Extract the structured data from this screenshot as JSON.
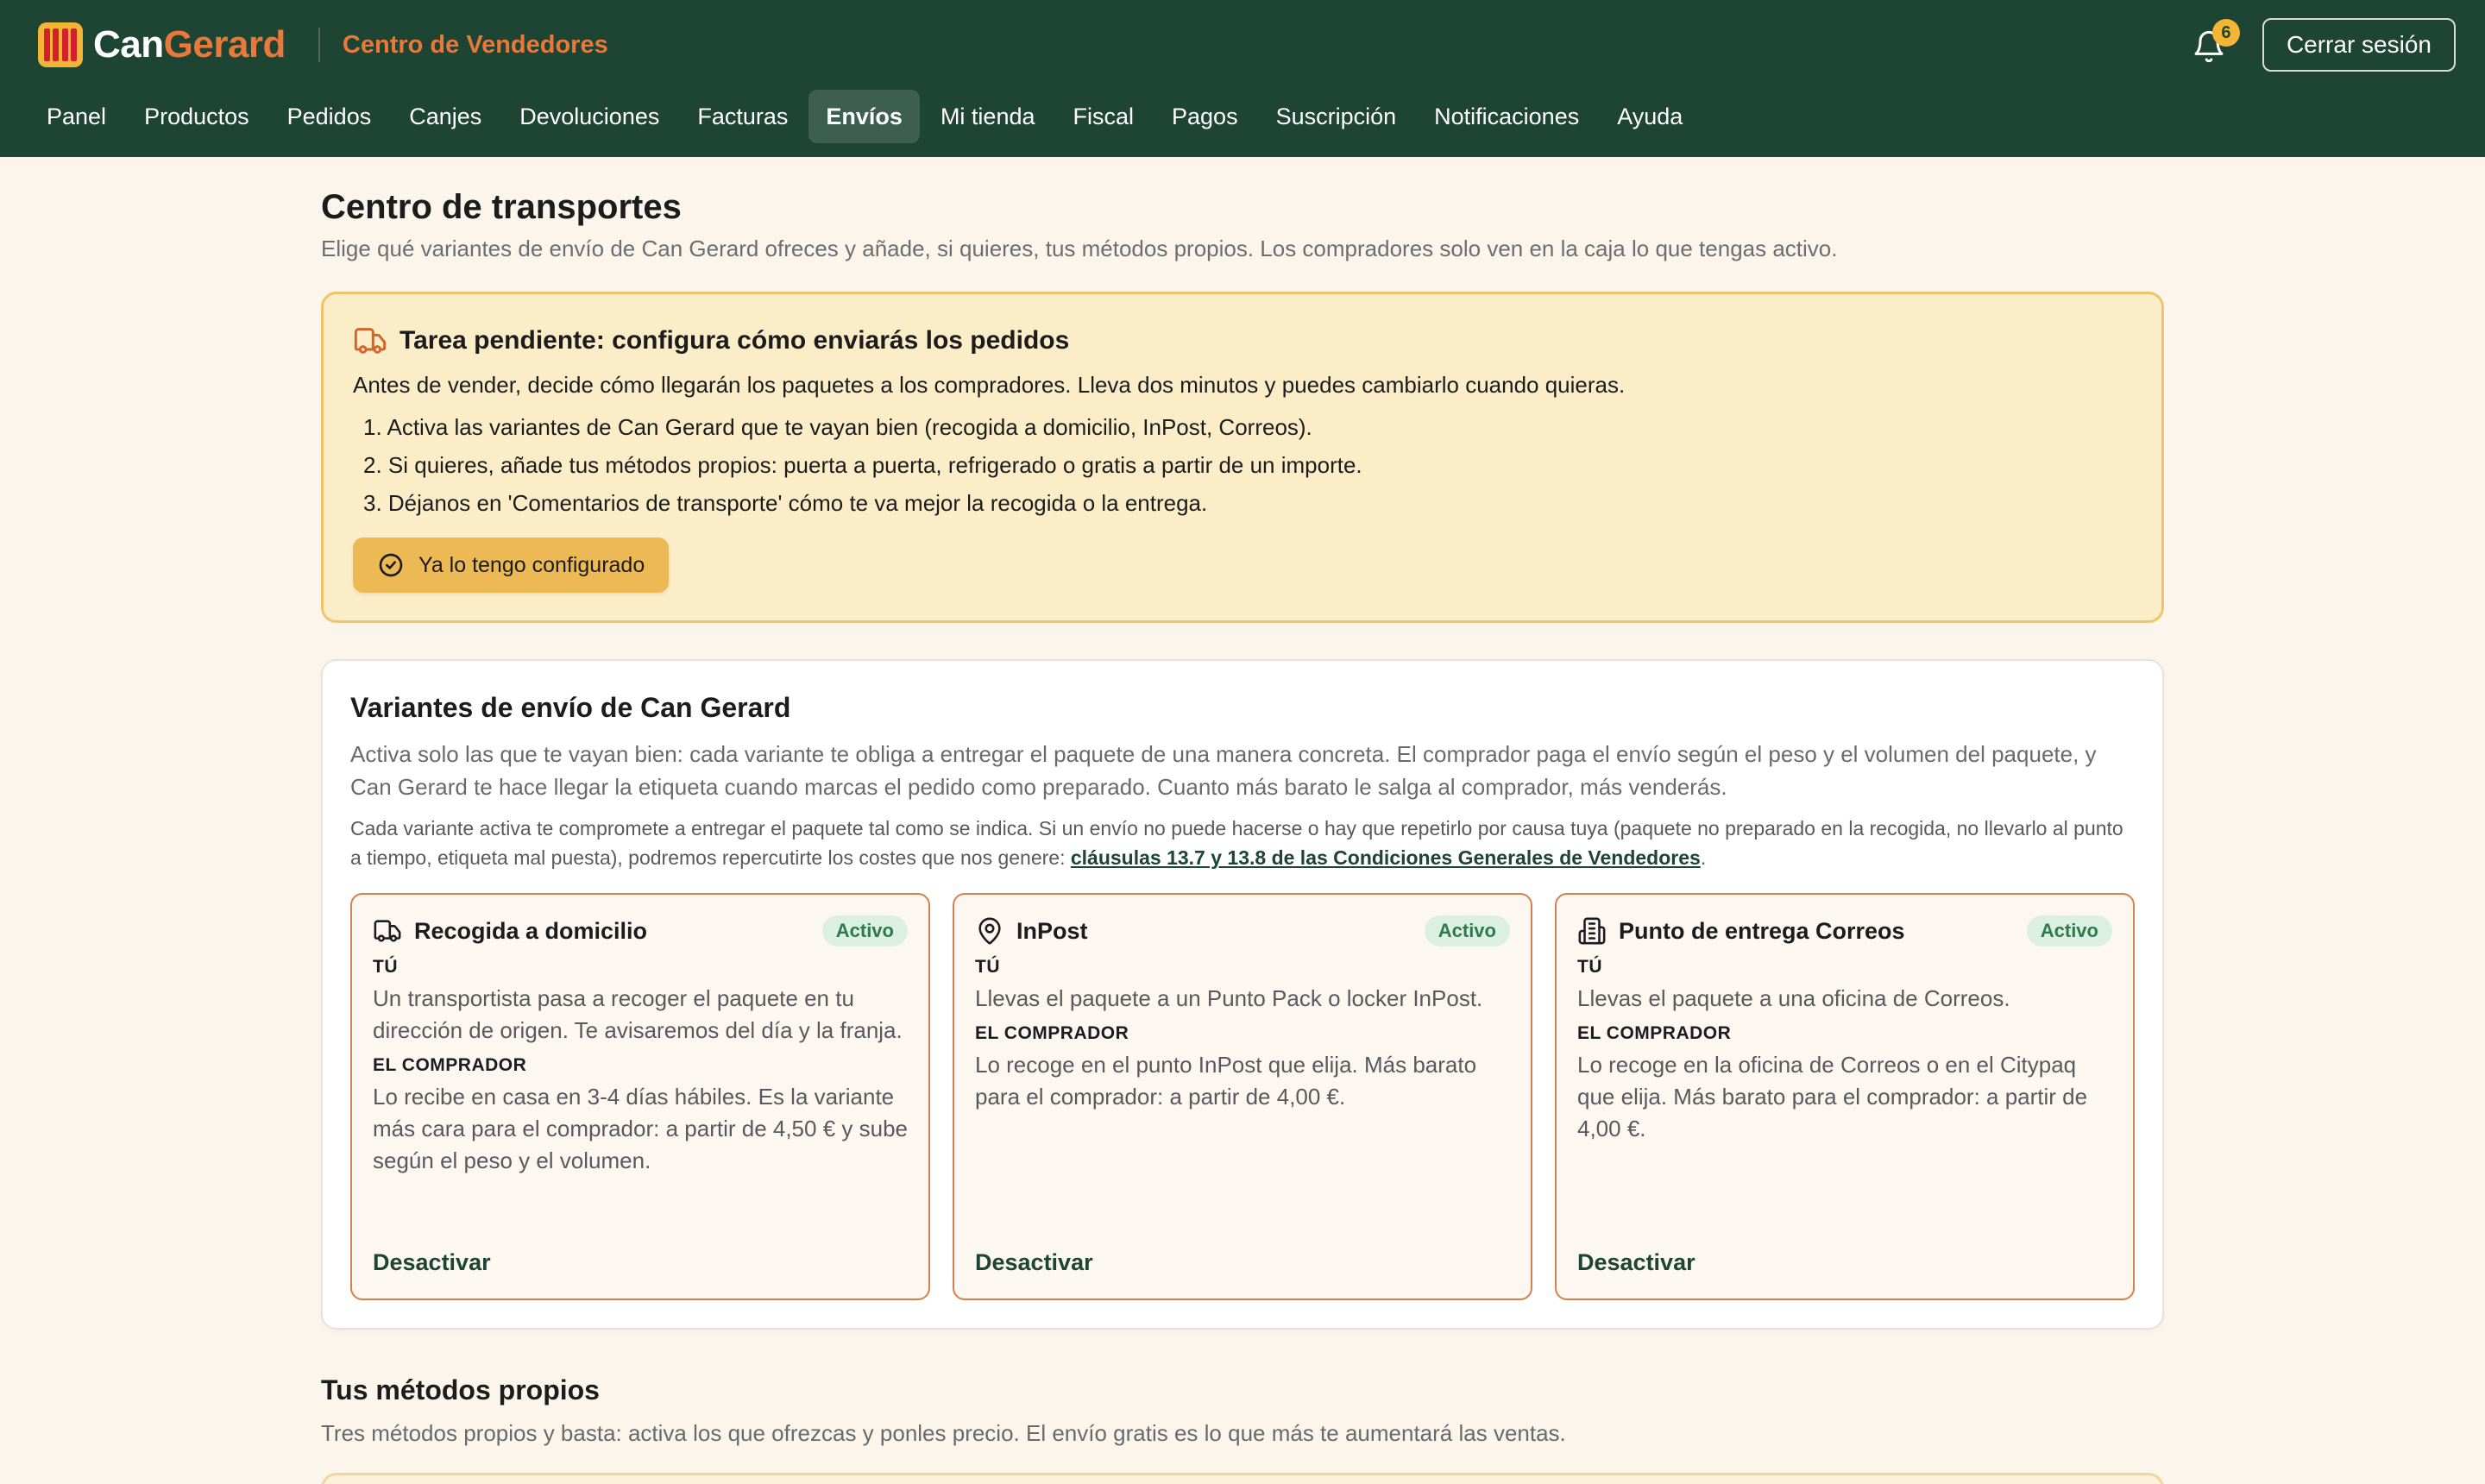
{
  "brand": {
    "name_part1": "Can",
    "name_part2": "Gerard",
    "portal": "Centro de Vendedores",
    "colors": {
      "header_bg": "#1e4433",
      "accent_orange": "#e8793b",
      "accent_yellow": "#f2b634"
    }
  },
  "header": {
    "notifications_count": "6",
    "logout_label": "Cerrar sesión",
    "bell_icon": "bell-icon"
  },
  "nav": {
    "items": [
      {
        "label": "Panel"
      },
      {
        "label": "Productos"
      },
      {
        "label": "Pedidos"
      },
      {
        "label": "Canjes"
      },
      {
        "label": "Devoluciones"
      },
      {
        "label": "Facturas"
      },
      {
        "label": "Envíos",
        "active": true
      },
      {
        "label": "Mi tienda"
      },
      {
        "label": "Fiscal"
      },
      {
        "label": "Pagos"
      },
      {
        "label": "Suscripción"
      },
      {
        "label": "Notificaciones"
      },
      {
        "label": "Ayuda"
      }
    ]
  },
  "page": {
    "title": "Centro de transportes",
    "subtitle": "Elige qué variantes de envío de Can Gerard ofreces y añade, si quieres, tus métodos propios. Los compradores solo ven en la caja lo que tengas activo."
  },
  "task": {
    "title": "Tarea pendiente: configura cómo enviarás los pedidos",
    "intro": "Antes de vender, decide cómo llegarán los paquetes a los compradores. Lleva dos minutos y puedes cambiarlo cuando quieras.",
    "steps": [
      "1. Activa las variantes de Can Gerard que te vayan bien (recogida a domicilio, InPost, Correos).",
      "2. Si quieres, añade tus métodos propios: puerta a puerta, refrigerado o gratis a partir de un importe.",
      "3. Déjanos en 'Comentarios de transporte' cómo te va mejor la recogida o la entrega."
    ],
    "button_label": "Ya lo tengo configurado"
  },
  "variants_section": {
    "title": "Variantes de envío de Can Gerard",
    "description": "Activa solo las que te vayan bien: cada variante te obliga a entregar el paquete de una manera concreta. El comprador paga el envío según el peso y el volumen del paquete, y Can Gerard te hace llegar la etiqueta cuando marcas el pedido como preparado. Cuanto más barato le salga al comprador, más venderás.",
    "note_text": "Cada variante activa te compromete a entregar el paquete tal como se indica. Si un envío no puede hacerse o hay que repetirlo por causa tuya (paquete no preparado en la recogida, no llevarlo al punto a tiempo, etiqueta mal puesta), podremos repercutirte los costes que nos genere: ",
    "note_link": "cláusulas 13.7 y 13.8 de las Condiciones Generales de Vendedores",
    "note_end": ".",
    "variants": [
      {
        "icon": "truck-icon",
        "title": "Recogida a domicilio",
        "status": "Activo",
        "you_label": "TÚ",
        "you_text": "Un transportista pasa a recoger el paquete en tu dirección de origen. Te avisaremos del día y la franja.",
        "buyer_label": "EL COMPRADOR",
        "buyer_text": "Lo recibe en casa en 3-4 días hábiles. Es la variante más cara para el comprador: a partir de 4,50 € y sube según el peso y el volumen.",
        "action": "Desactivar"
      },
      {
        "icon": "map-pin-icon",
        "title": "InPost",
        "status": "Activo",
        "you_label": "TÚ",
        "you_text": "Llevas el paquete a un Punto Pack o locker InPost.",
        "buyer_label": "EL COMPRADOR",
        "buyer_text": "Lo recoge en el punto InPost que elija. Más barato para el comprador: a partir de 4,00 €.",
        "action": "Desactivar"
      },
      {
        "icon": "building-icon",
        "title": "Punto de entrega Correos",
        "status": "Activo",
        "you_label": "TÚ",
        "you_text": "Llevas el paquete a una oficina de Correos.",
        "buyer_label": "EL COMPRADOR",
        "buyer_text": "Lo recoge en la oficina de Correos o en el Citypaq que elija. Más barato para el comprador: a partir de 4,00 €.",
        "action": "Desactivar"
      }
    ]
  },
  "own_methods": {
    "title": "Tus métodos propios",
    "subtitle": "Tres métodos propios y basta: activa los que ofrezcas y ponles precio. El envío gratis es lo que más te aumentará las ventas."
  }
}
